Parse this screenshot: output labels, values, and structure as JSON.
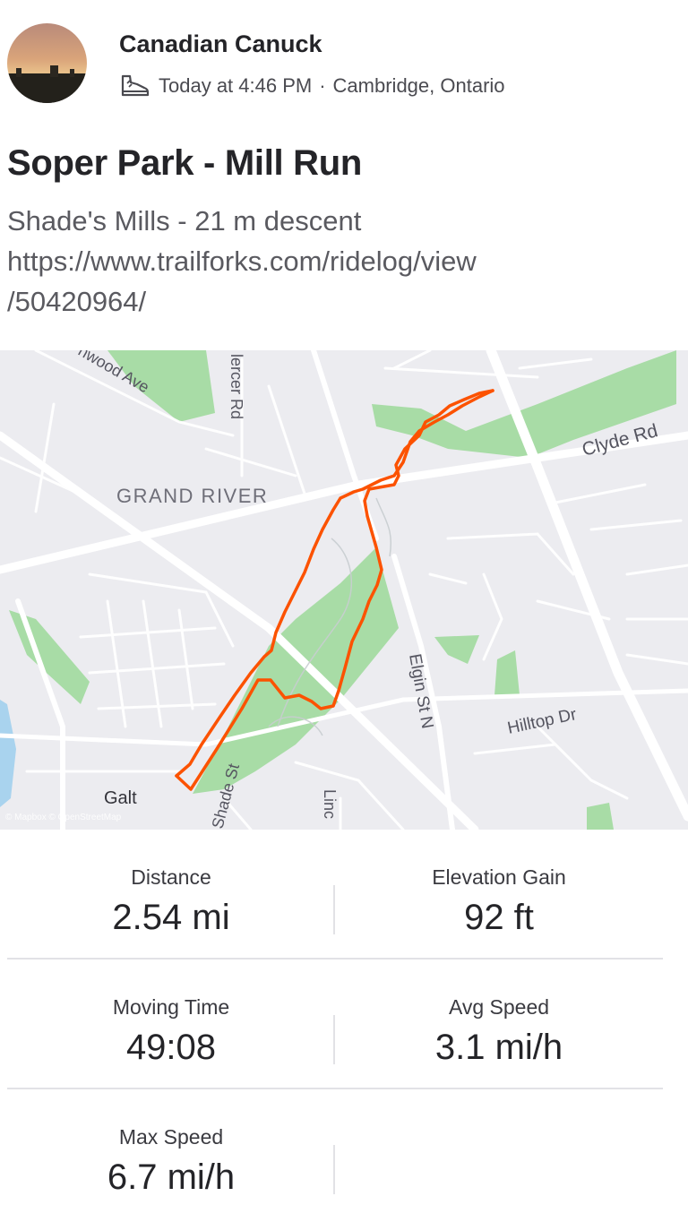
{
  "athlete": {
    "name": "Canadian Canuck",
    "time": "Today at 4:46 PM",
    "separator": "·",
    "location": "Cambridge, Ontario",
    "activity_icon": "hiking-boot-icon"
  },
  "activity": {
    "title": "Soper Park - Mill Run",
    "description_lines": [
      "Shade's Mills - 21 m descent",
      "https://www.trailforks.com/ridelog/view",
      "/50420964/"
    ]
  },
  "map": {
    "labels": {
      "wood_ave": "nwood Ave",
      "mercer_rd": "lercer Rd",
      "clyde_rd": "Clyde Rd",
      "grand_river": "GRAND RIVER",
      "elgin_st": "Elgin St N",
      "hilltop_dr": "Hilltop Dr",
      "galt": "Galt",
      "shade_st": "Shade St",
      "linc": "Linc",
      "attribution": "© Mapbox © OpenStreetMap"
    },
    "route_color": "#fc5200",
    "park_color": "#a8dca6",
    "water_color": "#a9d3ee"
  },
  "stats": {
    "distance": {
      "label": "Distance",
      "value": "2.54 mi"
    },
    "elevation_gain": {
      "label": "Elevation Gain",
      "value": "92 ft"
    },
    "moving_time": {
      "label": "Moving Time",
      "value": "49:08"
    },
    "avg_speed": {
      "label": "Avg Speed",
      "value": "3.1 mi/h"
    },
    "max_speed": {
      "label": "Max Speed",
      "value": "6.7 mi/h"
    }
  }
}
